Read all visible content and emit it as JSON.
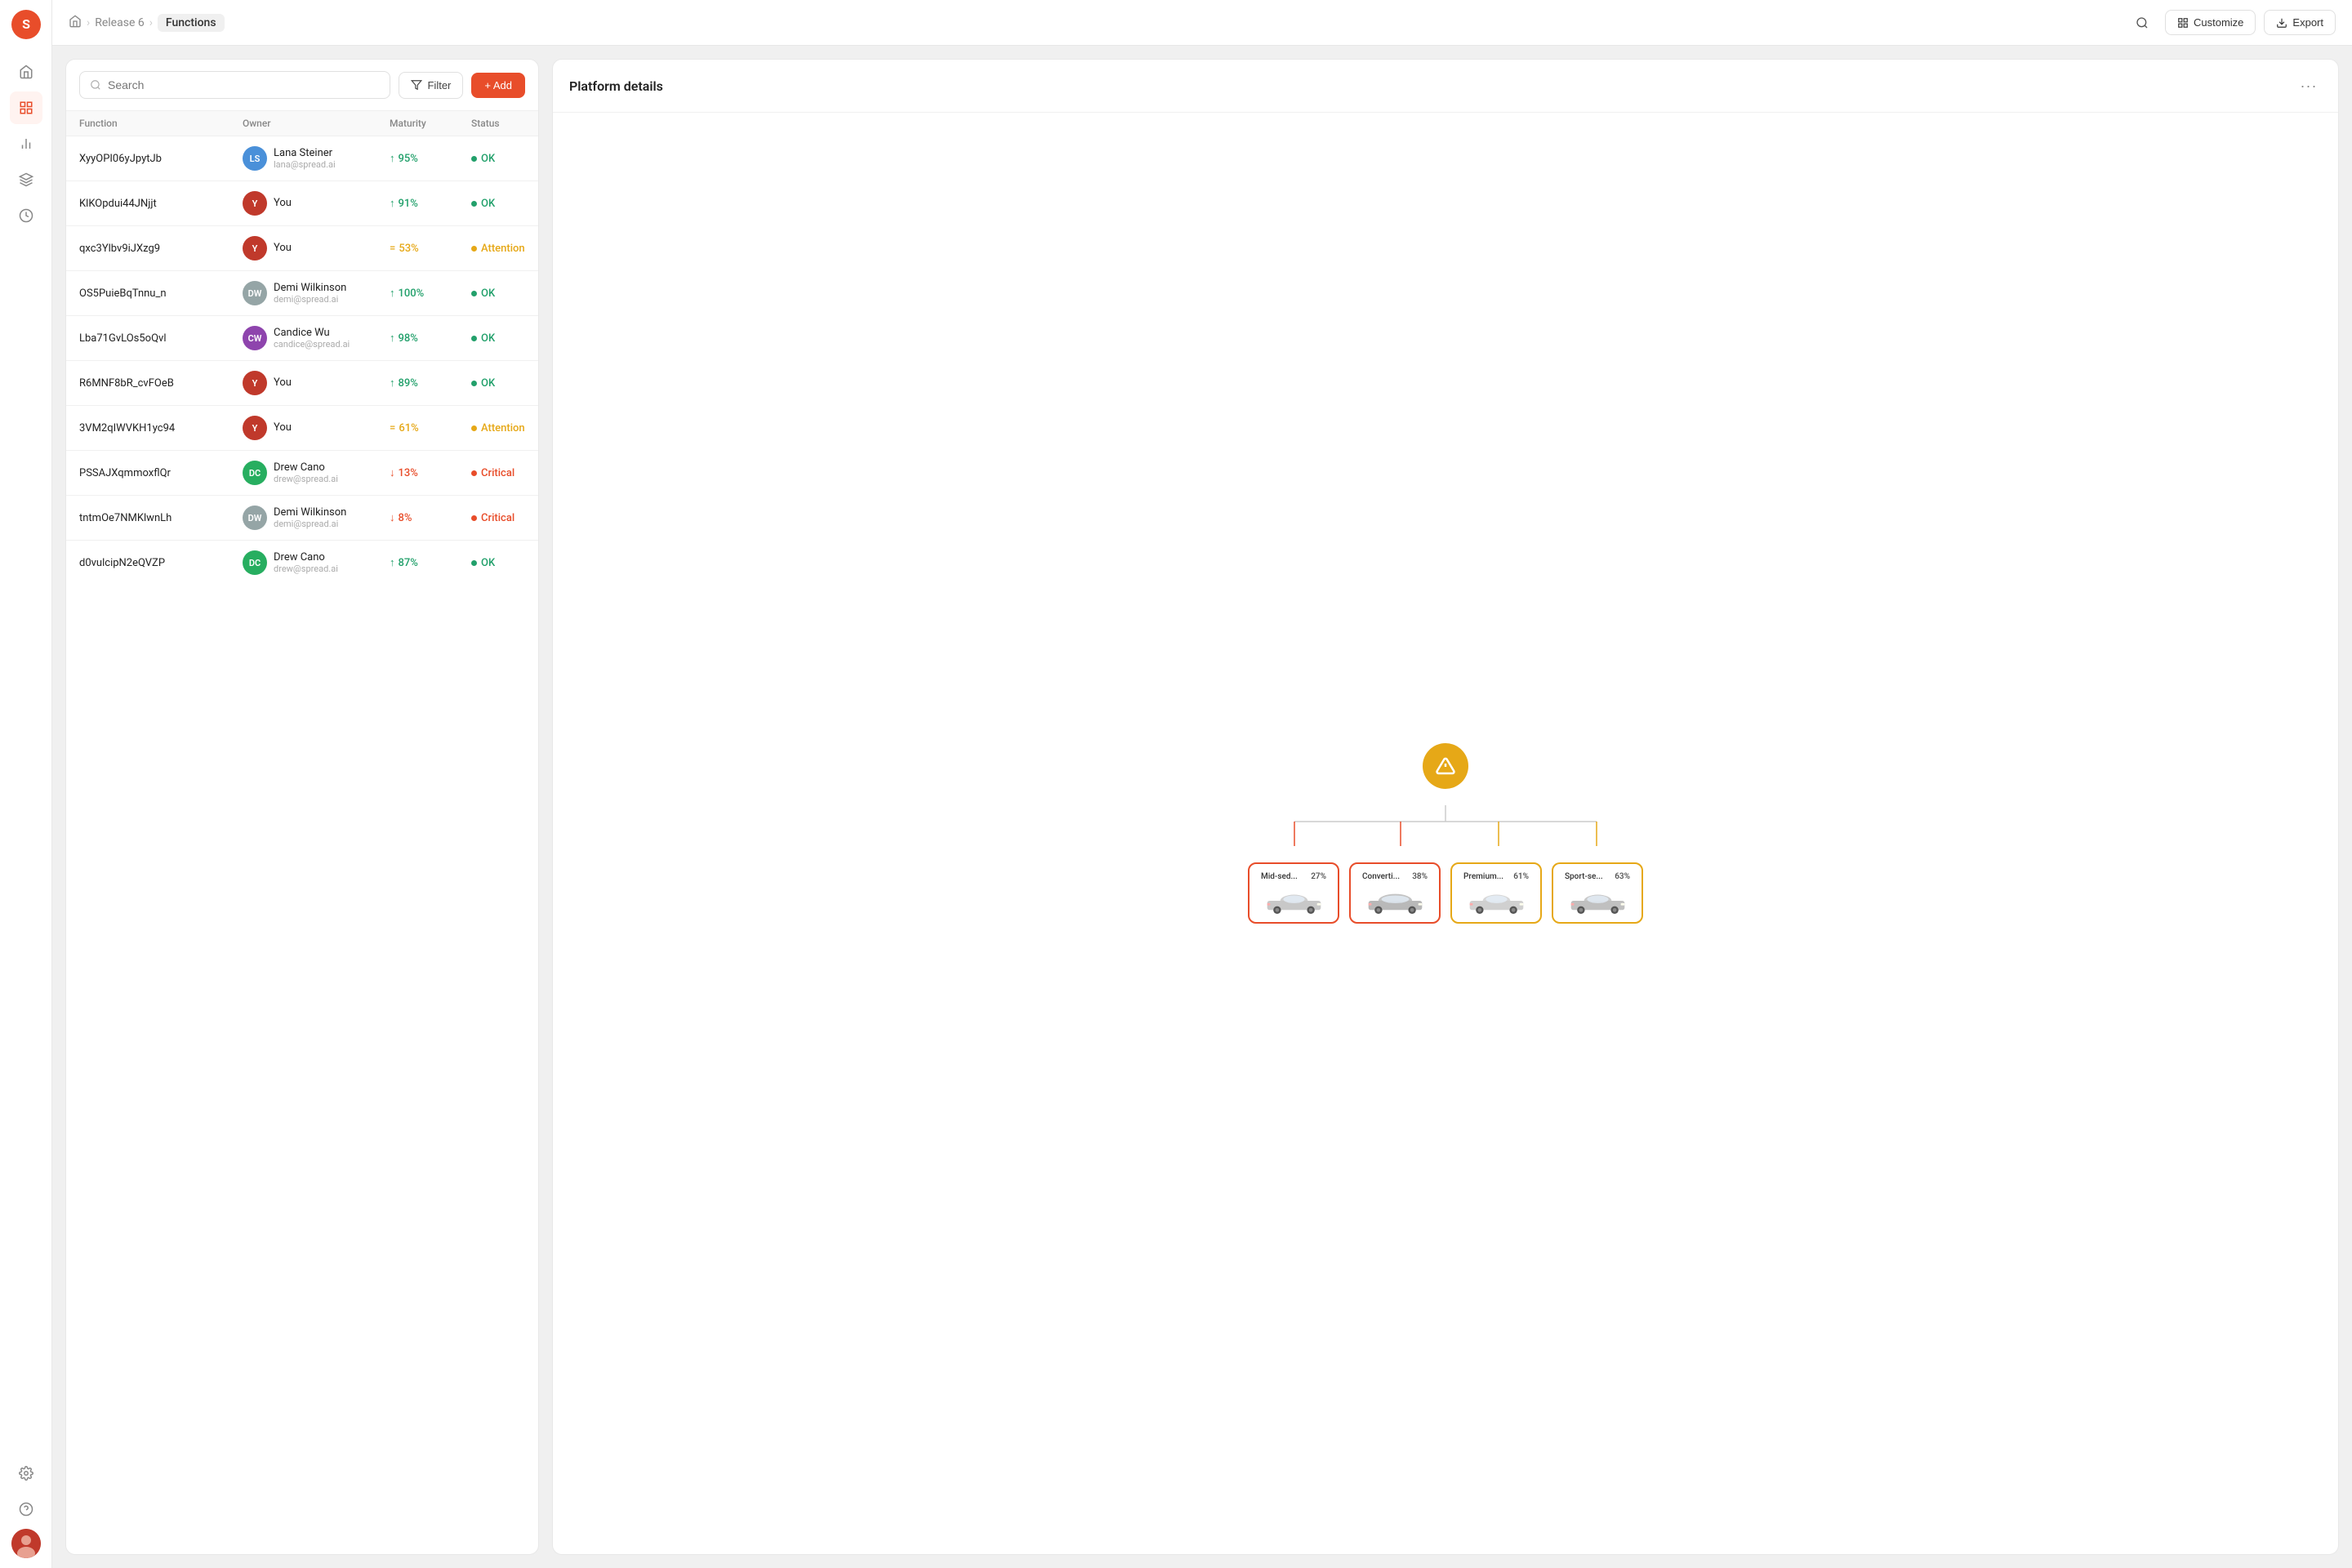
{
  "sidebar": {
    "logo_text": "S",
    "items": [
      {
        "id": "home",
        "icon": "⌂",
        "label": "Home"
      },
      {
        "id": "dashboard",
        "icon": "▦",
        "label": "Dashboard"
      },
      {
        "id": "chart",
        "icon": "📊",
        "label": "Analytics"
      },
      {
        "id": "layers",
        "icon": "⊞",
        "label": "Layers"
      },
      {
        "id": "clock",
        "icon": "◷",
        "label": "History"
      }
    ],
    "bottom_items": [
      {
        "id": "settings",
        "icon": "⚙",
        "label": "Settings"
      },
      {
        "id": "help",
        "icon": "?",
        "label": "Help"
      }
    ]
  },
  "topbar": {
    "breadcrumb": [
      {
        "label": "Home",
        "type": "icon"
      },
      {
        "label": "Release 6"
      },
      {
        "label": "Functions",
        "active": true
      }
    ],
    "customize_label": "Customize",
    "export_label": "Export"
  },
  "left_panel": {
    "search_placeholder": "Search",
    "filter_label": "Filter",
    "add_label": "+ Add",
    "columns": [
      "Function",
      "Owner",
      "Maturity",
      "Status"
    ],
    "rows": [
      {
        "function": "XyyOPI06yJpytJb",
        "owner_name": "Lana Steiner",
        "owner_email": "lana@spread.ai",
        "owner_initials": "LS",
        "owner_color": "av-blue",
        "maturity": "95%",
        "maturity_dir": "up",
        "maturity_color": "green",
        "status": "OK",
        "status_type": "ok"
      },
      {
        "function": "KlKOpdui44JNjjt",
        "owner_name": "You",
        "owner_email": "",
        "owner_initials": "Y",
        "owner_color": "av-red",
        "maturity": "91%",
        "maturity_dir": "up",
        "maturity_color": "green",
        "status": "OK",
        "status_type": "ok"
      },
      {
        "function": "qxc3Ylbv9iJXzg9",
        "owner_name": "You",
        "owner_email": "",
        "owner_initials": "Y",
        "owner_color": "av-red",
        "maturity": "53%",
        "maturity_dir": "flat",
        "maturity_color": "orange",
        "status": "Attention",
        "status_type": "attention"
      },
      {
        "function": "OS5PuieBqTnnu_n",
        "owner_name": "Demi Wilkinson",
        "owner_email": "demi@spread.ai",
        "owner_initials": "DW",
        "owner_color": "av-gray",
        "maturity": "100%",
        "maturity_dir": "up",
        "maturity_color": "green",
        "status": "OK",
        "status_type": "ok"
      },
      {
        "function": "Lba71GvLOs5oQvl",
        "owner_name": "Candice Wu",
        "owner_email": "candice@spread.ai",
        "owner_initials": "CW",
        "owner_color": "av-purple",
        "maturity": "98%",
        "maturity_dir": "up",
        "maturity_color": "green",
        "status": "OK",
        "status_type": "ok"
      },
      {
        "function": "R6MNF8bR_cvFOeB",
        "owner_name": "You",
        "owner_email": "",
        "owner_initials": "Y",
        "owner_color": "av-red",
        "maturity": "89%",
        "maturity_dir": "up",
        "maturity_color": "green",
        "status": "OK",
        "status_type": "ok"
      },
      {
        "function": "3VM2qIWVKH1yc94",
        "owner_name": "You",
        "owner_email": "",
        "owner_initials": "Y",
        "owner_color": "av-red",
        "maturity": "61%",
        "maturity_dir": "flat",
        "maturity_color": "orange",
        "status": "Attention",
        "status_type": "attention"
      },
      {
        "function": "PSSAJXqmmoxflQr",
        "owner_name": "Drew Cano",
        "owner_email": "drew@spread.ai",
        "owner_initials": "DC",
        "owner_color": "av-green",
        "maturity": "13%",
        "maturity_dir": "down",
        "maturity_color": "red",
        "status": "Critical",
        "status_type": "critical"
      },
      {
        "function": "tntmOe7NMKlwnLh",
        "owner_name": "Demi Wilkinson",
        "owner_email": "demi@spread.ai",
        "owner_initials": "DW",
        "owner_color": "av-gray",
        "maturity": "8%",
        "maturity_dir": "down",
        "maturity_color": "red",
        "status": "Critical",
        "status_type": "critical"
      },
      {
        "function": "d0vulcipN2eQVZP",
        "owner_name": "Drew Cano",
        "owner_email": "drew@spread.ai",
        "owner_initials": "DC",
        "owner_color": "av-green",
        "maturity": "87%",
        "maturity_dir": "up",
        "maturity_color": "green",
        "status": "OK",
        "status_type": "ok"
      }
    ]
  },
  "right_panel": {
    "title": "Platform details",
    "more_label": "···",
    "diagram": {
      "root_icon": "⚠",
      "cards": [
        {
          "name": "Mid-sed...",
          "pct": "27%",
          "border": "red"
        },
        {
          "name": "Converti...",
          "pct": "38%",
          "border": "red"
        },
        {
          "name": "Premium...",
          "pct": "61%",
          "border": "orange"
        },
        {
          "name": "Sport-se...",
          "pct": "63%",
          "border": "orange"
        }
      ]
    }
  }
}
